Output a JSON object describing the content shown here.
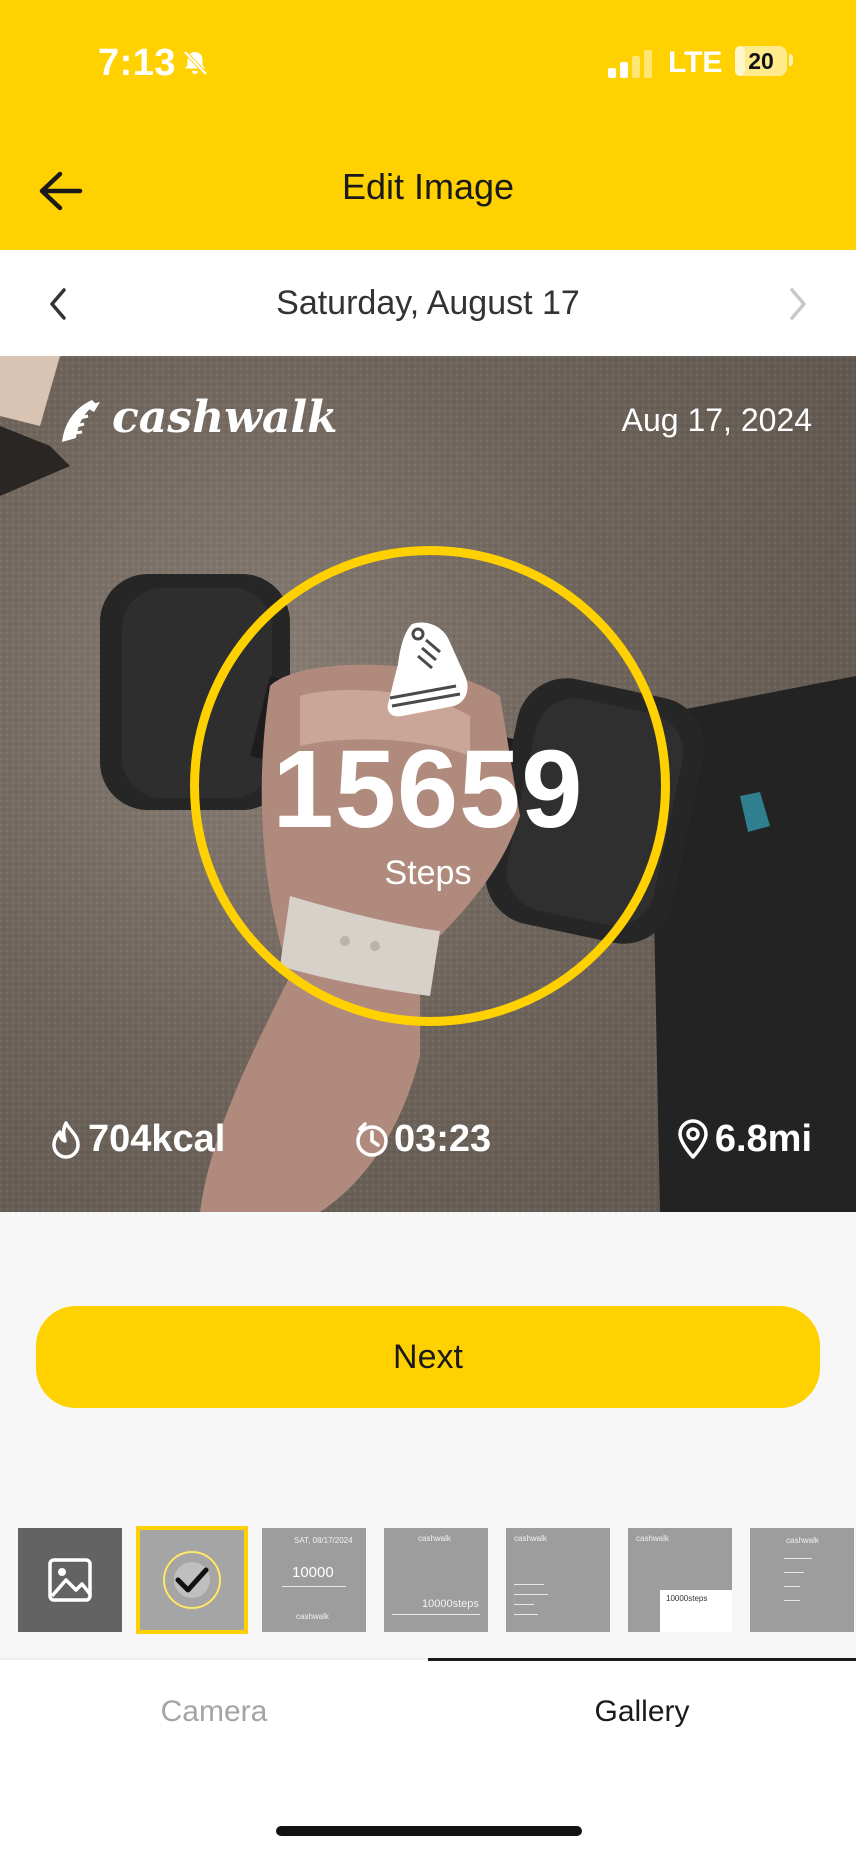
{
  "status_bar": {
    "time": "7:13",
    "network": "LTE",
    "battery_level": "20",
    "battery_fraction": 0.2,
    "icons": [
      "bell-slash-icon",
      "signal-icon",
      "battery-icon"
    ]
  },
  "header": {
    "title": "Edit Image",
    "back_icon": "arrow-left-icon"
  },
  "date_nav": {
    "date": "Saturday, August 17",
    "prev_icon": "chevron-left-icon",
    "next_icon": "chevron-right-icon"
  },
  "photo_card": {
    "brand": "cashwalk",
    "date": "Aug 17, 2024",
    "steps": "15659",
    "steps_label": "Steps",
    "calories": "704kcal",
    "duration": "03:23",
    "distance": "6.8mi",
    "ring_color": "#ffd100",
    "icons": [
      "shoe-icon",
      "flame-icon",
      "clock-icon",
      "location-pin-icon"
    ]
  },
  "next_button": {
    "label": "Next",
    "color": "#ffd100"
  },
  "thumbnails": {
    "selected_index": 1,
    "selected_icon": "checkmark-icon",
    "gallery_icon": "image-icon",
    "t2": {
      "header": "SAT, 08/17/2024",
      "value": "10000",
      "brand": "cashwalk"
    },
    "t3": {
      "brand": "cashwalk",
      "value": "10000steps"
    },
    "t4": {
      "brand": "cashwalk"
    },
    "t5": {
      "brand": "cashwalk",
      "value": "10000steps"
    },
    "t6": {
      "brand": "cashwalk"
    }
  },
  "tabs": [
    {
      "label": "Camera",
      "active": false
    },
    {
      "label": "Gallery",
      "active": true
    }
  ],
  "colors": {
    "accent": "#ffd100",
    "text": "#1a1a1a",
    "inactive_tab": "#a4a4a4"
  }
}
